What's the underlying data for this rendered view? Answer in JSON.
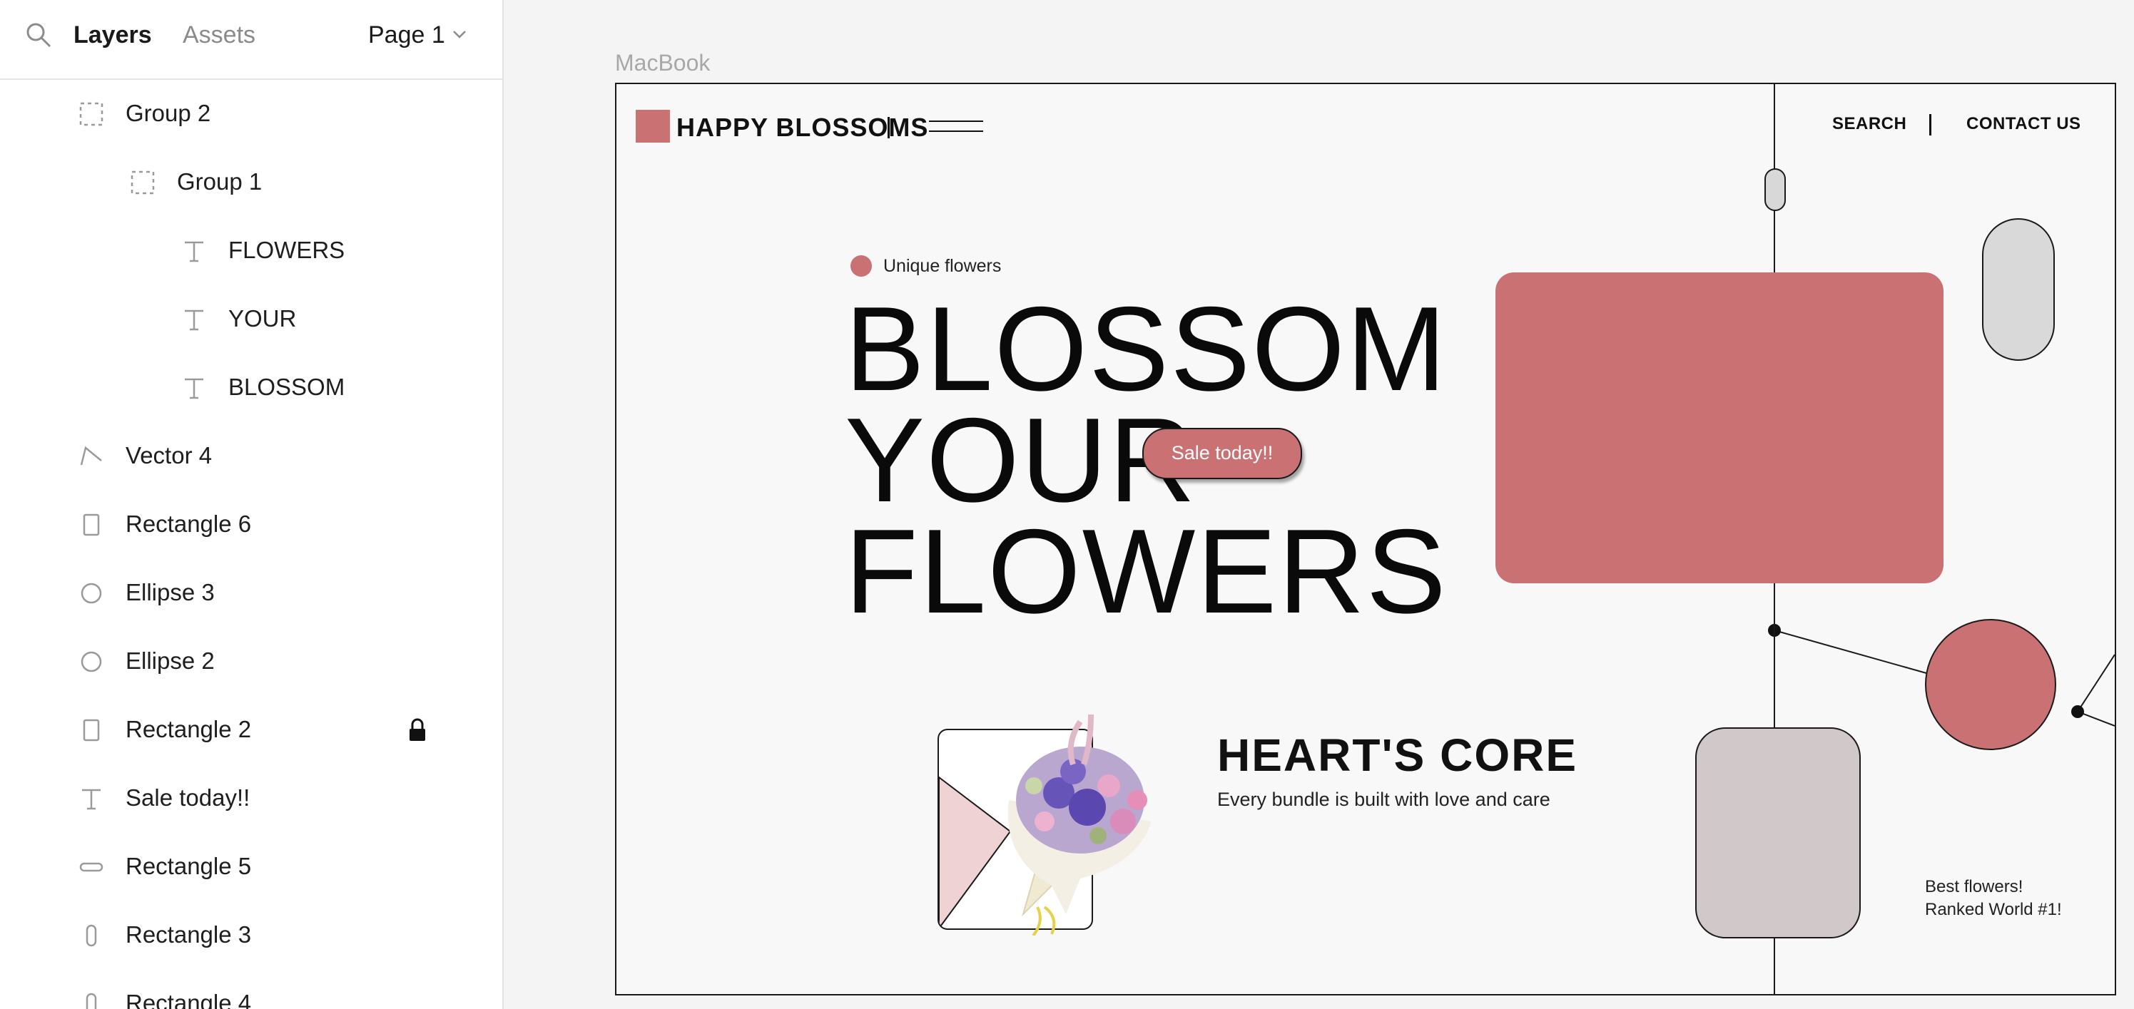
{
  "panel": {
    "tabs": {
      "layers": "Layers",
      "assets": "Assets"
    },
    "page": "Page 1",
    "layers": [
      {
        "label": "Group 2",
        "icon": "group-icon"
      },
      {
        "label": "Group 1",
        "icon": "group-icon"
      },
      {
        "label": "FLOWERS",
        "icon": "text-icon"
      },
      {
        "label": "YOUR",
        "icon": "text-icon"
      },
      {
        "label": "BLOSSOM",
        "icon": "text-icon"
      },
      {
        "label": "Vector 4",
        "icon": "vector-icon"
      },
      {
        "label": "Rectangle 6",
        "icon": "rectangle-icon"
      },
      {
        "label": "Ellipse 3",
        "icon": "ellipse-icon"
      },
      {
        "label": "Ellipse 2",
        "icon": "ellipse-icon"
      },
      {
        "label": "Rectangle 2",
        "icon": "rectangle-icon",
        "locked": true
      },
      {
        "label": "Sale today!!",
        "icon": "text-icon"
      },
      {
        "label": "Rectangle 5",
        "icon": "rounded-rect-icon"
      },
      {
        "label": "Rectangle 3",
        "icon": "pill-icon"
      },
      {
        "label": "Rectangle 4",
        "icon": "pill-icon"
      }
    ]
  },
  "canvas": {
    "frame_label": "MacBook",
    "site": {
      "brand": "HAPPY BLOSSOMS",
      "nav": {
        "search": "SEARCH",
        "contact": "CONTACT US"
      },
      "tagline": "Unique flowers",
      "hero": [
        "BLOSSOM",
        "YOUR",
        "FLOWERS"
      ],
      "sale_button": "Sale today!!",
      "feature_title": "HEART'S CORE",
      "feature_subtitle": "Every bundle is built with love and care",
      "badge": "Best flowers!\nRanked World #1!"
    }
  },
  "colors": {
    "accent": "#c97173",
    "gray_shape": "#d0c8c9",
    "light_pill": "#d9d9d9",
    "canvas_bg": "#f4f4f4"
  }
}
